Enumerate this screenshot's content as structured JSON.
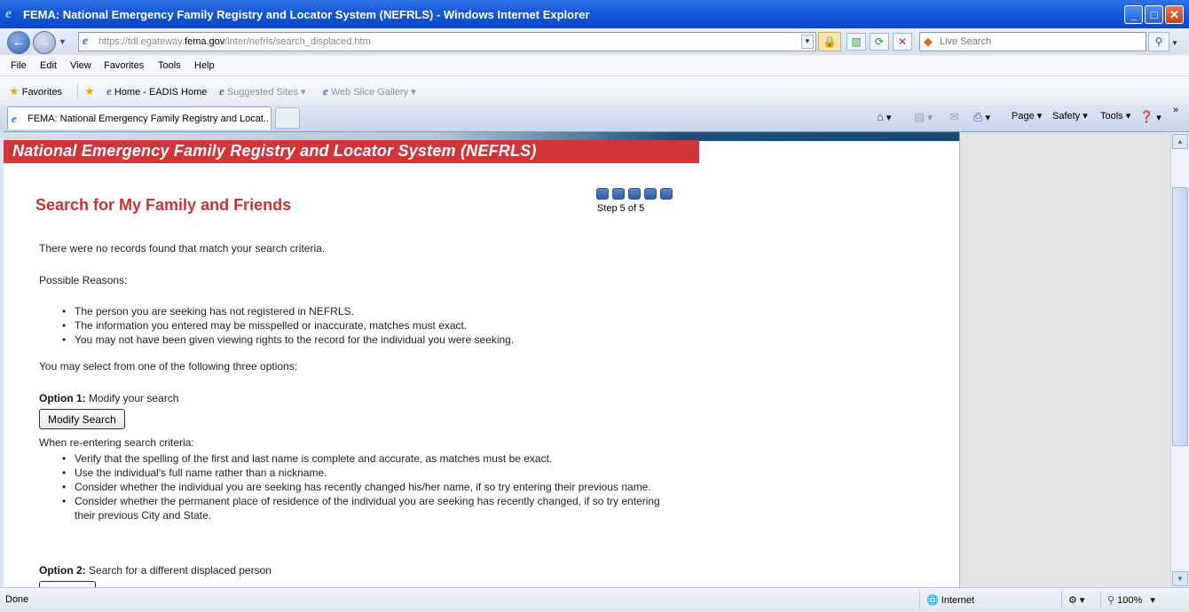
{
  "window": {
    "title": "FEMA: National Emergency Family Registry and Locator System (NEFRLS) - Windows Internet Explorer",
    "minimize_glyph": "_",
    "maximize_glyph": "□",
    "close_glyph": "✕"
  },
  "address": {
    "url_prefix": "https://tdl.egateway.",
    "url_domain": "fema.gov",
    "url_suffix": "/inter/nefrls/search_displaced.htm",
    "search_placeholder": "Live Search"
  },
  "menus": [
    "File",
    "Edit",
    "View",
    "Favorites",
    "Tools",
    "Help"
  ],
  "favorites_bar": {
    "favorites_label": "Favorites",
    "items": [
      {
        "label": "Home - EADIS Home"
      },
      {
        "label": "Suggested Sites ▾"
      },
      {
        "label": "Web Slice Gallery ▾"
      }
    ]
  },
  "tabs": {
    "active_label": "FEMA: National Emergency Family Registry and Locat..."
  },
  "command_bar": {
    "page": "Page ▾",
    "safety": "Safety ▾",
    "tools": "Tools ▾"
  },
  "page": {
    "banner": "National Emergency Family Registry and Locator System  (NEFRLS)",
    "heading": "Search for My Family and Friends",
    "step_text": "Step 5 of 5",
    "steps_total": 5,
    "steps_done": 5,
    "no_records": "There were no records found that match your search criteria.",
    "possible_reasons": "Possible Reasons:",
    "reasons": [
      "The person you are seeking has not registered in NEFRLS.",
      "The information you entered may be misspelled or inaccurate, matches must exact.",
      "You may not have been given viewing rights to the record for the individual you were seeking."
    ],
    "options_intro": "You may select from one of the following three options:",
    "option1_label": "Option 1:",
    "option1_text": " Modify your search",
    "modify_button": "Modify Search",
    "reenter_intro": "When re-entering search criteria:",
    "tips": [
      "Verify that the spelling of the first and last name is complete and accurate, as matches must be exact.",
      "Use the individual's full name rather than a nickname.",
      "Consider whether the individual you are seeking has recently changed his/her name, if so try entering their previous name.",
      "Consider whether the permanent place of residence of the individual you are seeking has recently changed, if so try entering their previous City and State."
    ],
    "option2_label": "Option 2:",
    "option2_text": " Search for a different displaced person"
  },
  "status": {
    "left": "Done",
    "zone": "Internet",
    "zoom": "100%"
  }
}
